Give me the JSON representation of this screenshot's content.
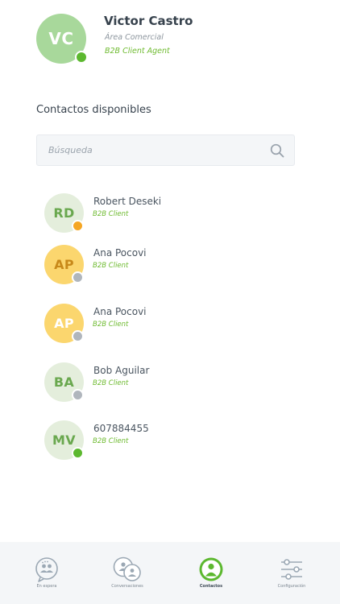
{
  "profile": {
    "initials": "VC",
    "name": "Victor Castro",
    "department": "Área Comercial",
    "role": "B2B Client Agent",
    "avatar_color": "#a8d89b",
    "status_color": "#5cb82f"
  },
  "section_title": "Contactos disponibles",
  "search": {
    "placeholder": "Búsqueda",
    "icon": "search-icon"
  },
  "contacts": [
    {
      "initials": "RD",
      "name": "Robert Deseki",
      "role": "B2B Client",
      "avatar_bg": "#e4eedc",
      "initials_color": "#6aa84f",
      "status_color": "#f5a623"
    },
    {
      "initials": "AP",
      "name": "Ana Pocovi",
      "role": "B2B Client",
      "avatar_bg": "#fbd66e",
      "initials_color": "#c8891a",
      "status_color": "#b0b6bd"
    },
    {
      "initials": "AP",
      "name": "Ana Pocovi",
      "role": "B2B Client",
      "avatar_bg": "#fbd66e",
      "initials_color": "#ffffff",
      "status_color": "#b0b6bd"
    },
    {
      "initials": "BA",
      "name": "Bob Aguilar",
      "role": "B2B Client",
      "avatar_bg": "#e4eedc",
      "initials_color": "#6aa84f",
      "status_color": "#b0b6bd"
    },
    {
      "initials": "MV",
      "name": "607884455",
      "role": "B2B Client",
      "avatar_bg": "#e4eedc",
      "initials_color": "#6aa84f",
      "status_color": "#5cb82f"
    }
  ],
  "nav": [
    {
      "label": "En espera",
      "icon": "waiting-icon",
      "active": false
    },
    {
      "label": "Conversaciones",
      "icon": "conversations-icon",
      "active": false
    },
    {
      "label": "Contactos",
      "icon": "contacts-icon",
      "active": true
    },
    {
      "label": "Configuración",
      "icon": "settings-icon",
      "active": false
    }
  ],
  "colors": {
    "accent": "#6dba2e",
    "nav_active": "#5cb82f",
    "nav_inactive": "#9ba8b4"
  }
}
